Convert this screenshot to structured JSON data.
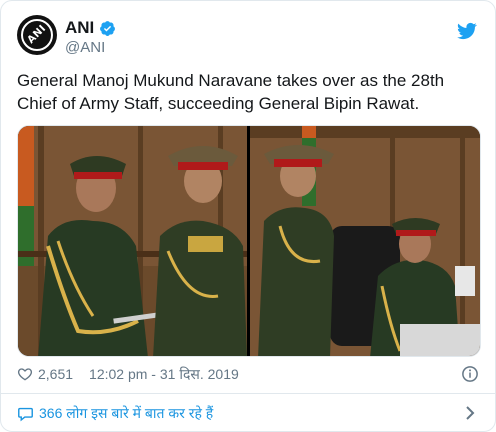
{
  "colors": {
    "accent": "#1da1f2",
    "link": "#1b95e0",
    "muted": "#657786",
    "text": "#14171a"
  },
  "author": {
    "name": "ANI",
    "handle": "@ANI",
    "avatar_text": "ANI",
    "verified": true
  },
  "tweet": {
    "text": "General Manoj Mukund Naravane takes over as the 28th Chief of Army Staff, succeeding General Bipin Rawat."
  },
  "meta": {
    "likes": "2,651",
    "timestamp": "12:02 pm - 31 दिस. 2019"
  },
  "footer": {
    "conversation_label": "366 लोग इस बारे में बात कर रहे हैं"
  },
  "icons": {
    "verified": "verified-badge-icon",
    "bird": "twitter-bird-icon",
    "heart": "heart-icon",
    "info": "info-icon",
    "bubble": "speech-bubble-icon",
    "chevron": "chevron-right-icon"
  }
}
